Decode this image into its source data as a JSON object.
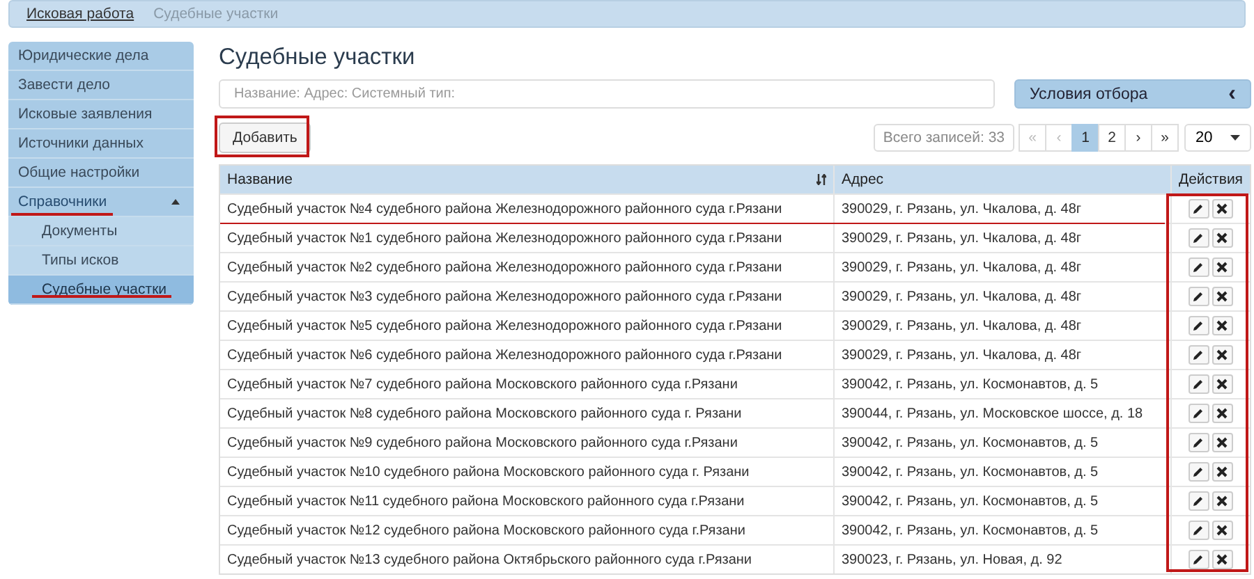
{
  "breadcrumb": [
    {
      "label": "Исковая работа",
      "selected": false
    },
    {
      "label": "Судебные участки",
      "selected": true
    }
  ],
  "sidebar": {
    "items": [
      {
        "label": "Юридические дела"
      },
      {
        "label": "Завести дело"
      },
      {
        "label": "Исковые заявления"
      },
      {
        "label": "Источники данных"
      },
      {
        "label": "Общие настройки"
      },
      {
        "label": "Справочники",
        "expanded": true,
        "children": [
          {
            "label": "Документы",
            "selected": false
          },
          {
            "label": "Типы исков",
            "selected": false
          },
          {
            "label": "Судебные участки",
            "selected": true
          }
        ]
      }
    ]
  },
  "page_title": "Судебные участки",
  "search": {
    "placeholder": "Название: Адрес: Системный тип:"
  },
  "filter_panel": {
    "label": "Условия отбора",
    "icon": "‹"
  },
  "add_button": "Добавить",
  "pagination": {
    "total": "Всего записей: 33",
    "pages": [
      {
        "label": "«",
        "selected": false,
        "disabled": true
      },
      {
        "label": "‹",
        "selected": false,
        "disabled": true
      },
      {
        "label": "1",
        "selected": true,
        "disabled": false
      },
      {
        "label": "2",
        "selected": false,
        "disabled": false
      },
      {
        "label": "›",
        "selected": false,
        "disabled": false
      },
      {
        "label": "»",
        "selected": false,
        "disabled": false
      }
    ],
    "page_size": "20"
  },
  "table": {
    "columns": [
      "Название",
      "Адрес",
      "Действия"
    ],
    "rows": [
      {
        "name": "Судебный участок №4 судебного района Железнодорожного районного суда г.Рязани",
        "address": "390029, г. Рязань, ул. Чкалова, д. 48г"
      },
      {
        "name": "Судебный участок №1 судебного района Железнодорожного районного суда г.Рязани",
        "address": "390029, г. Рязань, ул. Чкалова, д. 48г"
      },
      {
        "name": "Судебный участок №2 судебного района Железнодорожного районного суда г.Рязани",
        "address": "390029, г. Рязань, ул. Чкалова, д. 48г"
      },
      {
        "name": "Судебный участок №3 судебного района Железнодорожного районного суда г.Рязани",
        "address": "390029, г. Рязань, ул. Чкалова, д. 48г"
      },
      {
        "name": "Судебный участок №5 судебного района Железнодорожного районного суда г.Рязани",
        "address": "390029, г. Рязань, ул. Чкалова, д. 48г"
      },
      {
        "name": "Судебный участок №6 судебного района Железнодорожного районного суда г.Рязани",
        "address": "390029, г. Рязань, ул. Чкалова, д. 48г"
      },
      {
        "name": "Судебный участок №7 судебного района Московского районного суда г.Рязани",
        "address": "390042, г. Рязань, ул. Космонавтов, д. 5"
      },
      {
        "name": "Судебный участок №8 судебного района Московского районного суда г. Рязани",
        "address": "390044, г. Рязань, ул. Московское шоссе, д. 18"
      },
      {
        "name": "Судебный участок №9 судебного района Московского районного суда г.Рязани",
        "address": "390042, г. Рязань, ул. Космонавтов, д. 5"
      },
      {
        "name": "Судебный участок №10 судебного района Московского районного суда г. Рязани",
        "address": "390042, г. Рязань, ул. Космонавтов, д. 5"
      },
      {
        "name": "Судебный участок №11 судебного района Московского районного суда г.Рязани",
        "address": "390042, г. Рязань, ул. Космонавтов, д. 5"
      },
      {
        "name": "Судебный участок №12 судебного района Московского районного суда г.Рязани",
        "address": "390042, г. Рязань, ул. Космонавтов, д. 5"
      },
      {
        "name": "Судебный участок №13 судебного района Октябрьского районного суда г.Рязани",
        "address": "390023, г. Рязань, ул. Новая, д. 92"
      }
    ]
  }
}
